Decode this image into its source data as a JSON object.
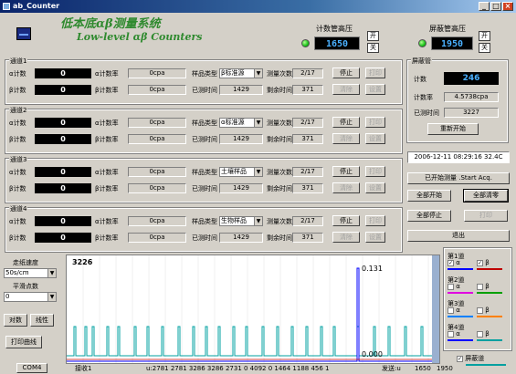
{
  "window": {
    "title": "ab_Counter",
    "min_label": "_",
    "max_label": "□",
    "close_label": "×"
  },
  "header": {
    "title_line1": "低本底αβ测量系统",
    "title_line2": "Low-level αβ Counters",
    "hv_counter": {
      "label": "计数管高压",
      "value": "1650",
      "on_label": "开",
      "off_label": "关"
    },
    "hv_guard": {
      "label": "屏蔽管高压",
      "value": "1950",
      "on_label": "开",
      "off_label": "关"
    }
  },
  "channels": [
    {
      "title": "通道1",
      "alpha_label": "α计数",
      "alpha_count": "0",
      "beta_label": "β计数",
      "beta_count": "0",
      "alpha_rate_label": "α计数率",
      "alpha_rate": "0cpa",
      "beta_rate_label": "β计数率",
      "beta_rate": "0cpa",
      "sample_type_label": "样品类型",
      "sample_type": "β标准源",
      "count_label": "测量次数",
      "count": "2/17",
      "elapsed_label": "已测时间",
      "elapsed": "1429",
      "remain_label": "剩余时间",
      "remain": "371",
      "stop": "停止",
      "print": "打印",
      "clear": "清除",
      "setup": "设置"
    },
    {
      "title": "通道2",
      "alpha_label": "α计数",
      "alpha_count": "0",
      "beta_label": "β计数",
      "beta_count": "0",
      "alpha_rate_label": "α计数率",
      "alpha_rate": "0cpa",
      "beta_rate_label": "β计数率",
      "beta_rate": "0cpa",
      "sample_type_label": "样品类型",
      "sample_type": "α标准源",
      "count_label": "测量次数",
      "count": "2/17",
      "elapsed_label": "已测时间",
      "elapsed": "1429",
      "remain_label": "剩余时间",
      "remain": "371",
      "stop": "停止",
      "print": "打印",
      "clear": "清除",
      "setup": "设置"
    },
    {
      "title": "通道3",
      "alpha_label": "α计数",
      "alpha_count": "0",
      "beta_label": "β计数",
      "beta_count": "0",
      "alpha_rate_label": "α计数率",
      "alpha_rate": "0cpa",
      "beta_rate_label": "β计数率",
      "beta_rate": "0cpa",
      "sample_type_label": "样品类型",
      "sample_type": "土壤样品",
      "count_label": "测量次数",
      "count": "2/17",
      "elapsed_label": "已测时间",
      "elapsed": "1429",
      "remain_label": "剩余时间",
      "remain": "371",
      "stop": "停止",
      "print": "打印",
      "clear": "清除",
      "setup": "设置"
    },
    {
      "title": "通道4",
      "alpha_label": "α计数",
      "alpha_count": "0",
      "beta_label": "β计数",
      "beta_count": "0",
      "alpha_rate_label": "α计数率",
      "alpha_rate": "0cpa",
      "beta_rate_label": "β计数率",
      "beta_rate": "0cpa",
      "sample_type_label": "样品类型",
      "sample_type": "生物样品",
      "count_label": "测量次数",
      "count": "2/17",
      "elapsed_label": "已测时间",
      "elapsed": "1429",
      "remain_label": "剩余时间",
      "remain": "371",
      "stop": "停止",
      "print": "打印",
      "clear": "清除",
      "setup": "设置"
    }
  ],
  "guard": {
    "title": "屏蔽管",
    "count_label": "计数",
    "count": "246",
    "rate_label": "计数率",
    "rate": "4.5738cpa",
    "elapsed_label": "已测时间",
    "elapsed": "3227",
    "restart": "重新开始"
  },
  "right_panel": {
    "datetime": "2006-12-11 08:29:16 32.4C",
    "status": "已开始测量 .Start Acq.",
    "start_all": "全部开始",
    "clear_all": "全部清零",
    "stop_all": "全部停止",
    "print": "打印",
    "exit": "退出"
  },
  "left_controls": {
    "speed_label": "走纸速度",
    "speed_value": "50s/cm",
    "smooth_label": "平滑点数",
    "smooth_value": "0",
    "log_button": "对数",
    "linear_button": "线性",
    "print_curve_button": "打印曲线"
  },
  "plot": {
    "label_left": "3226",
    "label_right_top": "0.131",
    "label_right_bottom": "0.000"
  },
  "legend": {
    "channels": [
      {
        "title": "第1道",
        "alpha": "α",
        "beta": "β",
        "alpha_checked": true,
        "beta_checked": true,
        "alpha_color": "#0000ff",
        "beta_color": "#c00000"
      },
      {
        "title": "第2道",
        "alpha": "α",
        "beta": "β",
        "alpha_checked": false,
        "beta_checked": false,
        "alpha_color": "#e000e0",
        "beta_color": "#00a000"
      },
      {
        "title": "第3道",
        "alpha": "α",
        "beta": "β",
        "alpha_checked": false,
        "beta_checked": false,
        "alpha_color": "#0080ff",
        "beta_color": "#ff8000"
      },
      {
        "title": "第4道",
        "alpha": "α",
        "beta": "β",
        "alpha_checked": false,
        "beta_checked": false,
        "alpha_color": "#0000ff",
        "beta_color": "#00a0a0"
      }
    ],
    "guard_label": "屏蔽道",
    "guard_checked": true,
    "guard_color": "#00a0a0"
  },
  "statusbar": {
    "port": "COM4",
    "recv": "接收1",
    "data": "u:2781 2781 3286 3286 2731  0 4092  0 1464 1188  456 1",
    "send": "发送:u",
    "hv1": "1650",
    "hv2": "1950"
  }
}
